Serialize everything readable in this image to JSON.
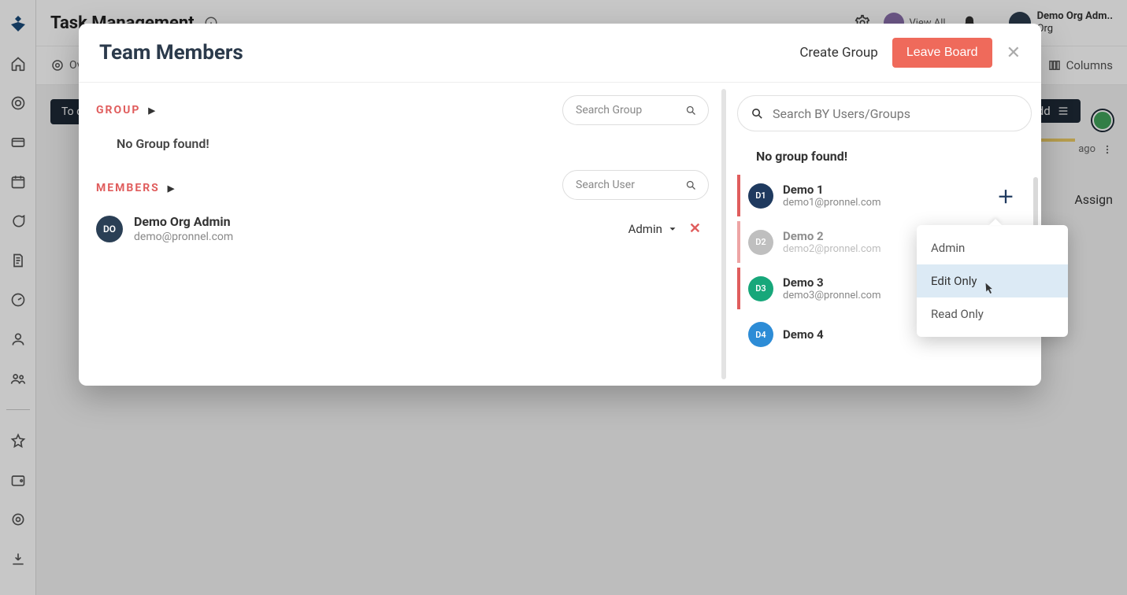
{
  "page": {
    "title": "Task Management",
    "overview_label": "Ov",
    "columns_label": "Columns",
    "view_all_label": "View All",
    "org_user": "Demo Org Adm..",
    "org_name": "Org"
  },
  "board": {
    "todo_label": "To do",
    "add_label": "Add",
    "ago_label": "ago",
    "assign_label": "Assign"
  },
  "modal": {
    "title": "Team Members",
    "create_group_label": "Create Group",
    "leave_board_label": "Leave Board",
    "group_section": "GROUP",
    "members_section": "MEMBERS",
    "no_group_msg": "No Group found!",
    "search_group_placeholder": "Search Group",
    "search_user_placeholder": "Search User",
    "search_big_placeholder": "Search BY Users/Groups",
    "members": [
      {
        "initials": "DO",
        "name": "Demo Org Admin",
        "email": "demo@pronnel.com",
        "role": "Admin"
      }
    ],
    "right_no_group": "No group found!",
    "users": [
      {
        "initials": "D1",
        "name": "Demo 1",
        "email": "demo1@pronnel.com"
      },
      {
        "initials": "D2",
        "name": "Demo 2",
        "email": "demo2@pronnel.com"
      },
      {
        "initials": "D3",
        "name": "Demo 3",
        "email": "demo3@pronnel.com"
      },
      {
        "initials": "D4",
        "name": "Demo 4",
        "email": ""
      }
    ]
  },
  "popover": {
    "options": [
      "Admin",
      "Edit Only",
      "Read Only"
    ],
    "highlight_index": 1
  }
}
